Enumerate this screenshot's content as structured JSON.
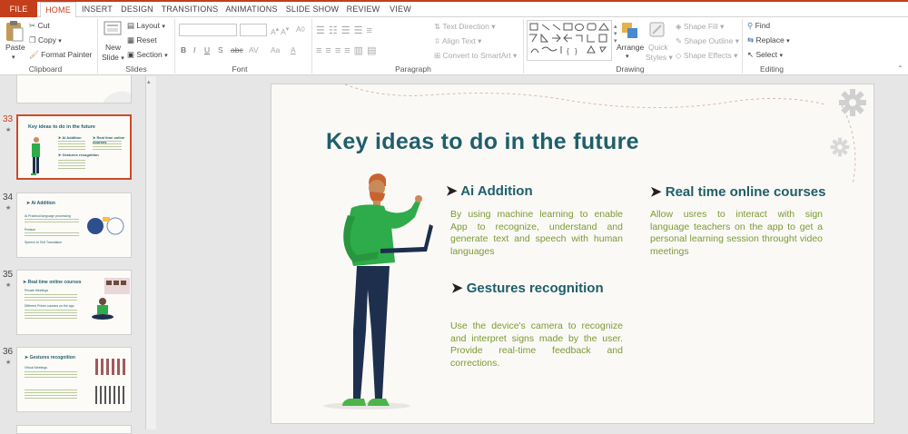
{
  "tabs": [
    "FILE",
    "HOME",
    "INSERT",
    "DESIGN",
    "TRANSITIONS",
    "ANIMATIONS",
    "SLIDE SHOW",
    "REVIEW",
    "VIEW"
  ],
  "ribbon": {
    "clipboard": {
      "label": "Clipboard",
      "paste": "Paste",
      "cut": "Cut",
      "copy": "Copy",
      "format_painter": "Format Painter"
    },
    "slides": {
      "label": "Slides",
      "new_slide": "New",
      "new_slide2": "Slide",
      "layout": "Layout",
      "reset": "Reset",
      "section": "Section"
    },
    "font": {
      "label": "Font",
      "bold": "B",
      "italic": "I",
      "underline": "U",
      "shadow": "S",
      "strike": "abc",
      "spacing": "AV",
      "case": "Aa",
      "clear": "A"
    },
    "paragraph": {
      "label": "Paragraph",
      "text_direction": "Text Direction",
      "align_text": "Align Text",
      "convert_smartart": "Convert to SmartArt"
    },
    "drawing": {
      "label": "Drawing",
      "arrange": "Arrange",
      "quick_styles": "Quick",
      "quick_styles2": "Styles",
      "shape_fill": "Shape Fill",
      "shape_outline": "Shape Outline",
      "shape_effects": "Shape Effects"
    },
    "editing": {
      "label": "Editing",
      "find": "Find",
      "replace": "Replace",
      "select": "Select"
    }
  },
  "thumbnails": [
    {
      "num": "33",
      "title": "Key ideas to do in the future"
    },
    {
      "num": "34",
      "title": "Ai Addition"
    },
    {
      "num": "35",
      "title": "Real time online courses"
    },
    {
      "num": "36",
      "title": "Gestures recognition"
    }
  ],
  "thumb_details": {
    "t33": [
      "Ai Addition",
      "Real time online courses",
      "Gestures recognition"
    ],
    "t34": [
      "Ai Practical language processing",
      "Preface",
      "Speech to Text Translation"
    ],
    "t35": [
      "Private Meetings",
      "Different Prices courses on the app"
    ],
    "t36": [
      "Virtual Meetings"
    ]
  },
  "slide": {
    "title": "Key ideas to do in the future",
    "sections": [
      {
        "heading": "Ai Addition",
        "text": "By using machine learning to enable App to recognize, understand and generate text and speech with human languages"
      },
      {
        "heading": "Real time online courses",
        "text": "Allow usres to interact with sign language teachers on the app to get a personal learning session throught video meetings"
      },
      {
        "heading": "Gestures recognition",
        "text": "Use the device's camera to recognize and interpret signs made by the user. Provide real-time feedback and corrections."
      }
    ]
  },
  "colors": {
    "accent": "#c43e1c",
    "title": "#1e5f6a",
    "body": "#7a9b34",
    "figure_shirt": "#2eab4a",
    "figure_pants": "#1d2f4d"
  }
}
